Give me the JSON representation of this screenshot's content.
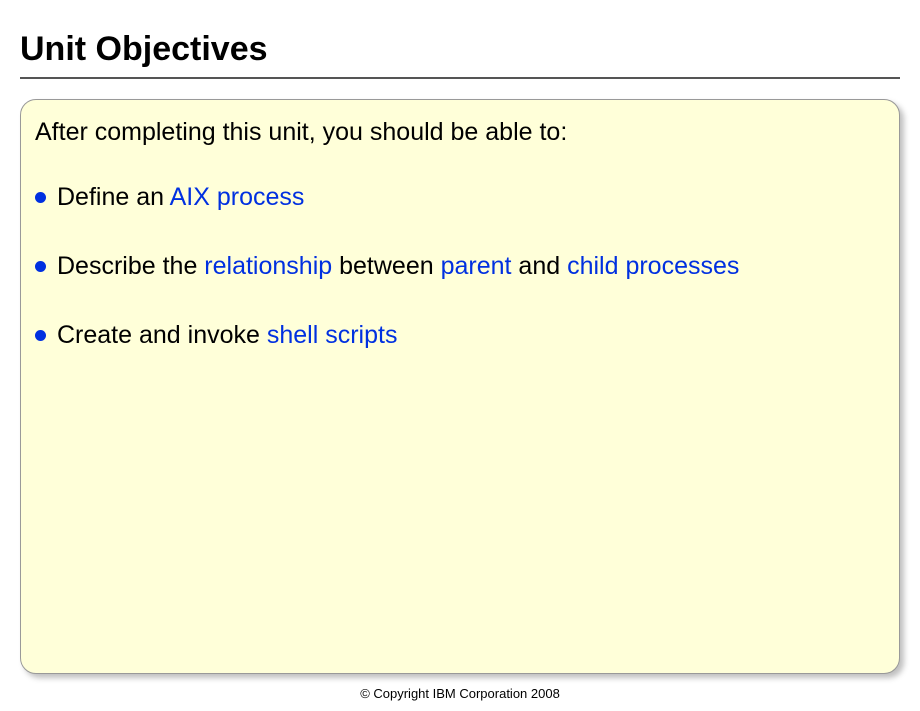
{
  "title": "Unit Objectives",
  "intro": "After completing this unit, you should be able to:",
  "bullets": [
    {
      "parts": [
        {
          "text": "Define an ",
          "hl": false
        },
        {
          "text": "AIX process",
          "hl": true
        }
      ]
    },
    {
      "parts": [
        {
          "text": "Describe the ",
          "hl": false
        },
        {
          "text": "relationship",
          "hl": true
        },
        {
          "text": " between ",
          "hl": false
        },
        {
          "text": "parent",
          "hl": true
        },
        {
          "text": " and ",
          "hl": false
        },
        {
          "text": "child processes",
          "hl": true
        }
      ]
    },
    {
      "parts": [
        {
          "text": "Create and invoke ",
          "hl": false
        },
        {
          "text": "shell scripts",
          "hl": true
        }
      ]
    }
  ],
  "copyright": "© Copyright IBM Corporation 2008"
}
